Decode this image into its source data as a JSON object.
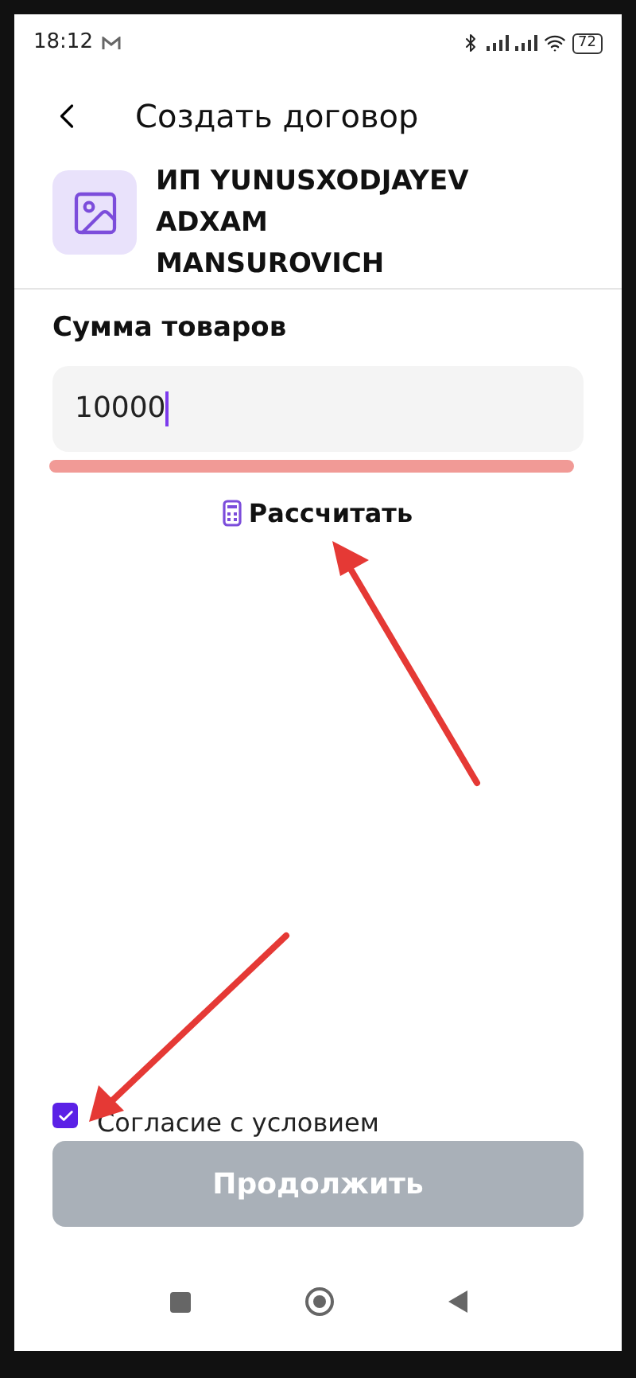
{
  "status_bar": {
    "time": "18:12",
    "battery": "72"
  },
  "header": {
    "title": "Создать договор"
  },
  "merchant": {
    "name": "ИП YUNUSXODJAYEV ADXAM MANSUROVICH"
  },
  "amount": {
    "label": "Сумма товаров",
    "value": "10000"
  },
  "calculate": {
    "label": "Рассчитать"
  },
  "agreement": {
    "label": "Согласие с условием",
    "checked": true
  },
  "continue_button": {
    "label": "Продолжить",
    "disabled": true
  }
}
